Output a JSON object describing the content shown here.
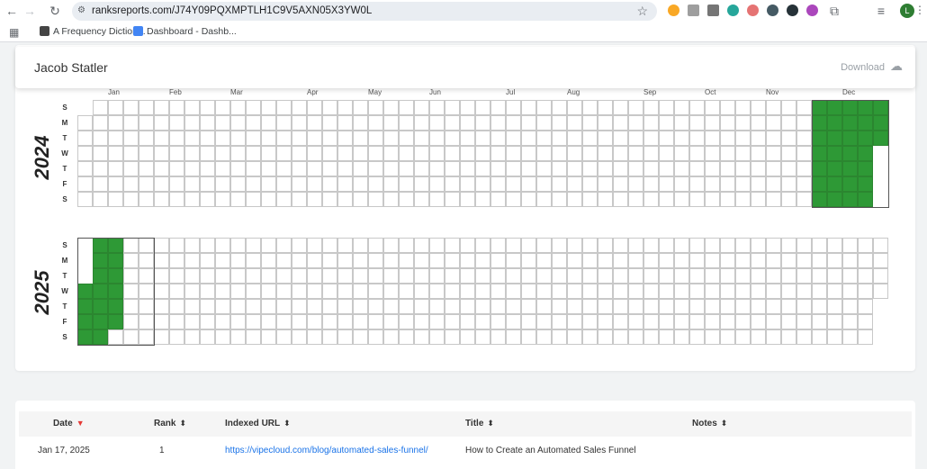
{
  "browser": {
    "url": "ranksreports.com/J74Y09PQXMPTLH1C9V5AXN05X3YW0L",
    "profile_initial": "L",
    "bookmarks": [
      {
        "label": "A Frequency Diction...",
        "color": "#444"
      },
      {
        "label": "Dashboard - Dashb...",
        "color": "#4285f4"
      }
    ]
  },
  "header": {
    "user_name": "Jacob Statler",
    "download_label": "Download"
  },
  "calendar": {
    "day_labels": [
      "S",
      "M",
      "T",
      "W",
      "T",
      "F",
      "S"
    ],
    "months": [
      "Jan",
      "Feb",
      "Mar",
      "Apr",
      "May",
      "Jun",
      "Jul",
      "Aug",
      "Sep",
      "Oct",
      "Nov",
      "Dec"
    ],
    "years": [
      "2024",
      "2025"
    ],
    "active_color": "#2e9936"
  },
  "table": {
    "columns": [
      {
        "label": "Date",
        "sort": "▼",
        "active": true
      },
      {
        "label": "Rank",
        "sort": "⬍",
        "active": false
      },
      {
        "label": "Indexed URL",
        "sort": "⬍",
        "active": false
      },
      {
        "label": "Title",
        "sort": "⬍",
        "active": false
      },
      {
        "label": "Notes",
        "sort": "⬍",
        "active": false
      }
    ],
    "rows": [
      {
        "date": "Jan 17, 2025",
        "rank": "1",
        "url": "https://vipecloud.com/blog/automated-sales-funnel/",
        "title": "How to Create an Automated Sales Funnel",
        "notes": ""
      }
    ]
  }
}
